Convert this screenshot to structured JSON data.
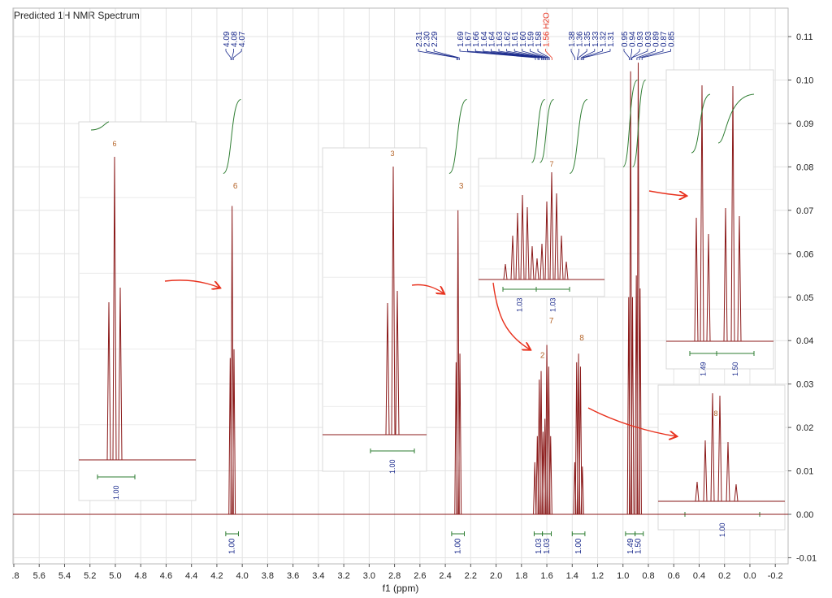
{
  "chart_data": {
    "type": "line",
    "title": "Predicted 1H NMR Spectrum",
    "xlabel": "f1 (ppm)",
    "ylabel": "",
    "xlim": [
      5.8,
      -0.2
    ],
    "ylim": [
      -0.01,
      0.11
    ],
    "x_reversed": true,
    "grid": true,
    "x_ticks": [
      5.8,
      5.6,
      5.4,
      5.2,
      5.0,
      4.8,
      4.6,
      4.4,
      4.2,
      4.0,
      3.8,
      3.6,
      3.4,
      3.2,
      3.0,
      2.8,
      2.6,
      2.4,
      2.2,
      2.0,
      1.8,
      1.6,
      1.4,
      1.2,
      1.0,
      0.8,
      0.6,
      0.4,
      0.2,
      0.0,
      -0.2
    ],
    "x_tick_labels": [
      ".8",
      "5.6",
      "5.4",
      "5.2",
      "5.0",
      "4.8",
      "4.6",
      "4.4",
      "4.2",
      "4.0",
      "3.8",
      "3.6",
      "3.4",
      "3.2",
      "3.0",
      "2.8",
      "2.6",
      "2.4",
      "2.2",
      "2.0",
      "1.8",
      "1.6",
      "1.4",
      "1.2",
      "1.0",
      "0.8",
      "0.6",
      "0.4",
      "0.2",
      "0.0",
      "-0.2"
    ],
    "y_ticks": [
      -0.01,
      0.0,
      0.01,
      0.02,
      0.03,
      0.04,
      0.05,
      0.06,
      0.07,
      0.08,
      0.09,
      0.1,
      0.11
    ],
    "y_tick_labels": [
      "-0.01",
      "0.00",
      "0.01",
      "0.02",
      "0.03",
      "0.04",
      "0.05",
      "0.06",
      "0.07",
      "0.08",
      "0.09",
      "0.10",
      "0.11"
    ],
    "peaks": [
      {
        "ppm": 4.095,
        "h": 0.036
      },
      {
        "ppm": 4.08,
        "h": 0.071
      },
      {
        "ppm": 4.065,
        "h": 0.038
      },
      {
        "ppm": 2.315,
        "h": 0.035
      },
      {
        "ppm": 2.3,
        "h": 0.07
      },
      {
        "ppm": 2.285,
        "h": 0.037
      },
      {
        "ppm": 1.695,
        "h": 0.012
      },
      {
        "ppm": 1.675,
        "h": 0.018
      },
      {
        "ppm": 1.66,
        "h": 0.031
      },
      {
        "ppm": 1.645,
        "h": 0.033
      },
      {
        "ppm": 1.63,
        "h": 0.019
      },
      {
        "ppm": 1.615,
        "h": 0.022
      },
      {
        "ppm": 1.6,
        "h": 0.039
      },
      {
        "ppm": 1.585,
        "h": 0.034
      },
      {
        "ppm": 1.57,
        "h": 0.018
      },
      {
        "ppm": 1.38,
        "h": 0.012
      },
      {
        "ppm": 1.365,
        "h": 0.035
      },
      {
        "ppm": 1.35,
        "h": 0.037
      },
      {
        "ppm": 1.335,
        "h": 0.034
      },
      {
        "ppm": 1.32,
        "h": 0.011
      },
      {
        "ppm": 0.955,
        "h": 0.05
      },
      {
        "ppm": 0.94,
        "h": 0.102
      },
      {
        "ppm": 0.925,
        "h": 0.05
      },
      {
        "ppm": 0.895,
        "h": 0.055
      },
      {
        "ppm": 0.88,
        "h": 0.104
      },
      {
        "ppm": 0.865,
        "h": 0.052
      }
    ],
    "integrals": [
      {
        "center": 4.08,
        "from": 4.13,
        "to": 4.03,
        "label": "1.00",
        "y_top": 0.0955,
        "y_bottom": 0.0785
      },
      {
        "center": 2.3,
        "from": 2.35,
        "to": 2.25,
        "label": "1.00",
        "y_top": 0.0955,
        "y_bottom": 0.0785
      },
      {
        "center": 1.665,
        "from": 1.7,
        "to": 1.635,
        "label": "1.03",
        "y_top": 0.0955,
        "y_bottom": 0.081
      },
      {
        "center": 1.6,
        "from": 1.635,
        "to": 1.565,
        "label": "1.03",
        "y_top": 0.0955,
        "y_bottom": 0.081
      },
      {
        "center": 1.35,
        "from": 1.4,
        "to": 1.3,
        "label": "1.00",
        "y_top": 0.0955,
        "y_bottom": 0.0785
      },
      {
        "center": 0.94,
        "from": 0.98,
        "to": 0.905,
        "label": "1.49",
        "y_top": 0.1,
        "y_bottom": 0.08
      },
      {
        "center": 0.88,
        "from": 0.905,
        "to": 0.84,
        "label": "1.50",
        "y_top": 0.1,
        "y_bottom": 0.08
      }
    ],
    "peak_labels": [
      {
        "ppm": 4.09,
        "label": "4.09"
      },
      {
        "ppm": 4.08,
        "label": "4.08"
      },
      {
        "ppm": 4.07,
        "label": "4.07"
      },
      {
        "ppm": 2.31,
        "label": "2.31"
      },
      {
        "ppm": 2.3,
        "label": "2.30"
      },
      {
        "ppm": 2.29,
        "label": "2.29"
      },
      {
        "ppm": 1.69,
        "label": "1.69"
      },
      {
        "ppm": 1.67,
        "label": "1.67"
      },
      {
        "ppm": 1.66,
        "label": "1.66"
      },
      {
        "ppm": 1.64,
        "label": "1.64"
      },
      {
        "ppm": 1.64,
        "label": "1.64"
      },
      {
        "ppm": 1.63,
        "label": "1.63"
      },
      {
        "ppm": 1.62,
        "label": "1.62"
      },
      {
        "ppm": 1.61,
        "label": "1.61"
      },
      {
        "ppm": 1.6,
        "label": "1.60"
      },
      {
        "ppm": 1.59,
        "label": "1.59"
      },
      {
        "ppm": 1.58,
        "label": "1.58"
      },
      {
        "ppm": 1.56,
        "label": "1.56 H2O",
        "color": "#e8321e"
      },
      {
        "ppm": 1.38,
        "label": "1.38"
      },
      {
        "ppm": 1.36,
        "label": "1.36"
      },
      {
        "ppm": 1.35,
        "label": "1.35"
      },
      {
        "ppm": 1.33,
        "label": "1.33"
      },
      {
        "ppm": 1.32,
        "label": "1.32"
      },
      {
        "ppm": 1.31,
        "label": "1.31"
      },
      {
        "ppm": 0.95,
        "label": "0.95"
      },
      {
        "ppm": 0.94,
        "label": "0.94"
      },
      {
        "ppm": 0.93,
        "label": "0.93"
      },
      {
        "ppm": 0.93,
        "label": "0.93"
      },
      {
        "ppm": 0.89,
        "label": "0.89"
      },
      {
        "ppm": 0.87,
        "label": "0.87"
      },
      {
        "ppm": 0.85,
        "label": "0.85"
      }
    ],
    "annotations": [
      {
        "text": "6",
        "ppm": 4.08,
        "y": 0.075
      },
      {
        "text": "3",
        "ppm": 2.3,
        "y": 0.075
      },
      {
        "text": "7",
        "ppm": 1.59,
        "y": 0.044
      },
      {
        "text": "2",
        "ppm": 1.66,
        "y": 0.036
      },
      {
        "text": "8",
        "ppm": 1.35,
        "y": 0.04
      }
    ],
    "insets": [
      {
        "group": "6",
        "integral": "1.00"
      },
      {
        "group": "3",
        "integral": "1.00"
      },
      {
        "group": "7",
        "integrals": [
          "1.03",
          "1.03"
        ]
      },
      {
        "group": "",
        "integrals": [
          "1.49",
          "1.50"
        ]
      },
      {
        "group": "8",
        "integral": "1.00"
      }
    ],
    "colors": {
      "spectrum": "#8b1a1a",
      "integral": "#2e7d32",
      "peak_label": "#1a2a8c",
      "annotation": "#b5652a",
      "arrow": "#e8321e"
    }
  }
}
